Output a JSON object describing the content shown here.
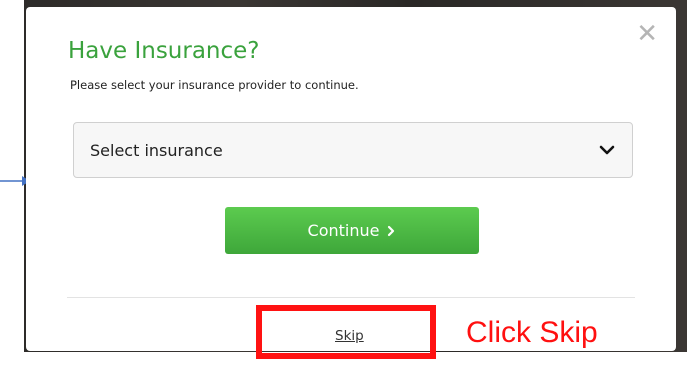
{
  "modal": {
    "close_symbol": "✕",
    "title": "Have Insurance?",
    "subtitle": "Please select your insurance provider to continue.",
    "select": {
      "value": "Select insurance",
      "icon": "chevron-down-icon"
    },
    "continue_button": {
      "label": "Continue",
      "icon": "chevron-right-icon"
    },
    "skip_label": "Skip"
  },
  "annotation": {
    "callout": "Click Skip",
    "highlight_color": "#ff1212",
    "arrow_color": "#4472c4"
  },
  "colors": {
    "title_green": "#3aa23d",
    "button_green": "#4cb947"
  }
}
